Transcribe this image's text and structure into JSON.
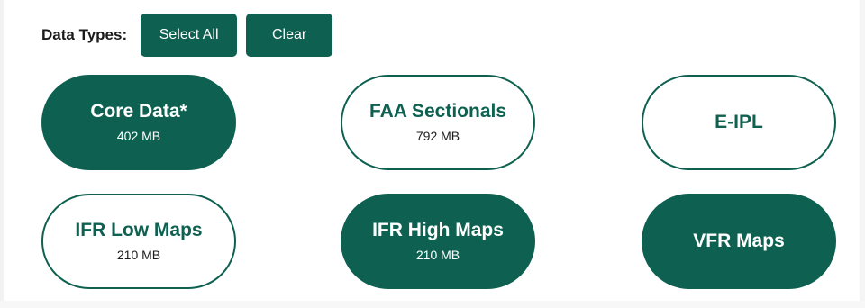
{
  "header": {
    "label": "Data Types:",
    "select_all_label": "Select All",
    "clear_label": "Clear"
  },
  "colors": {
    "accent": "#0e6150",
    "text_dark": "#1a1a1a",
    "background": "#ffffff"
  },
  "data_types": [
    {
      "title": "Core Data*",
      "size": "402 MB",
      "selected": true
    },
    {
      "title": "FAA Sectionals",
      "size": "792 MB",
      "selected": false
    },
    {
      "title": "E-IPL",
      "size": "",
      "selected": false
    },
    {
      "title": "IFR Low Maps",
      "size": "210 MB",
      "selected": false
    },
    {
      "title": "IFR High Maps",
      "size": "210 MB",
      "selected": true
    },
    {
      "title": "VFR Maps",
      "size": "",
      "selected": true
    }
  ]
}
